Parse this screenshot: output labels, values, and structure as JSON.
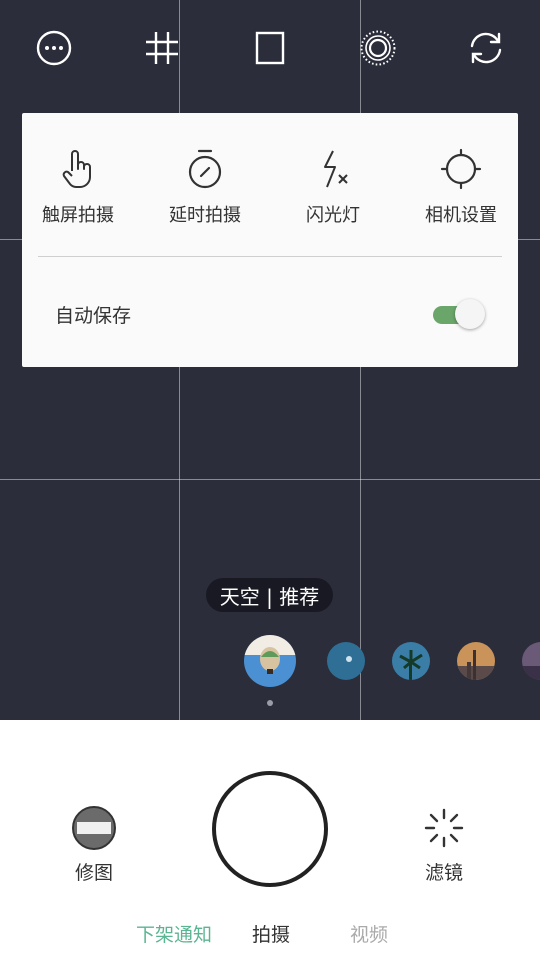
{
  "top_bar": {
    "icons": [
      "more-icon",
      "grid-icon",
      "aspect-ratio-icon",
      "live-photo-icon",
      "switch-camera-icon"
    ]
  },
  "settings_panel": {
    "options": [
      {
        "label": "触屏拍摄",
        "icon": "touch-icon"
      },
      {
        "label": "延时拍摄",
        "icon": "timer-icon"
      },
      {
        "label": "闪光灯",
        "icon": "flash-off-icon"
      },
      {
        "label": "相机设置",
        "icon": "camera-settings-icon"
      }
    ],
    "auto_save": {
      "label": "自动保存",
      "enabled": true
    }
  },
  "filter": {
    "current": "天空 | 推荐",
    "thumbnails": [
      "hot-air-balloon",
      "ocean",
      "palm-tree",
      "city-sunset",
      "dusk-sky"
    ]
  },
  "bottom_bar": {
    "edit_label": "修图",
    "filter_label": "滤镜",
    "tabs": [
      {
        "label": "下架通知",
        "state": "active"
      },
      {
        "label": "拍摄",
        "state": "selected"
      },
      {
        "label": "视频",
        "state": "inactive"
      }
    ]
  },
  "colors": {
    "viewfinder_bg": "#2b2d3a",
    "accent_green": "#5bb592",
    "toggle_on": "#6aa56a",
    "text_dark": "#333333",
    "text_muted": "#aaaaaa"
  }
}
